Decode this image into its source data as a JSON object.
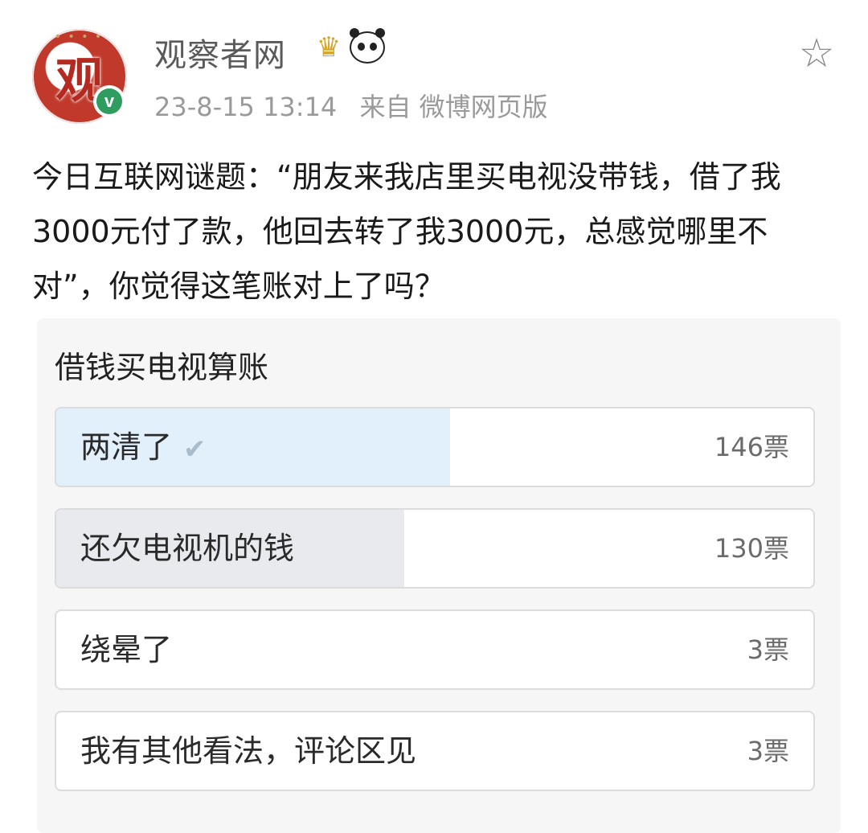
{
  "post": {
    "author": "观察者网",
    "time": "23-8-15 13:14",
    "source": "来自 微博网页版",
    "avatar_char": "观",
    "text": "今日互联网谜题：“朋友来我店里买电视没带钱，借了我3000元付了款，他回去转了我3000元，总感觉哪里不对”，你觉得这笔账对上了吗？"
  },
  "icons": {
    "verified": "verified-badge-icon",
    "medal": "medal-icon",
    "panda": "panda-icon",
    "favorite": "star-icon"
  },
  "poll": {
    "title": "借钱买电视算账",
    "options": [
      {
        "label": "两清了",
        "votes_text": "146票",
        "votes": 146,
        "selected": true,
        "fill_fraction": 0.52
      },
      {
        "label": "还欠电视机的钱",
        "votes_text": "130票",
        "votes": 130,
        "selected": false,
        "fill_fraction": 0.46
      },
      {
        "label": "绕晕了",
        "votes_text": "3票",
        "votes": 3,
        "selected": false,
        "fill_fraction": 0.0
      },
      {
        "label": "我有其他看法，评论区见",
        "votes_text": "3票",
        "votes": 3,
        "selected": false,
        "fill_fraction": 0.0
      }
    ]
  },
  "colors": {
    "selected_fill": "#e2f0fb",
    "bar_fill": "#e9eaee",
    "verified_green": "#2f9d5f"
  }
}
